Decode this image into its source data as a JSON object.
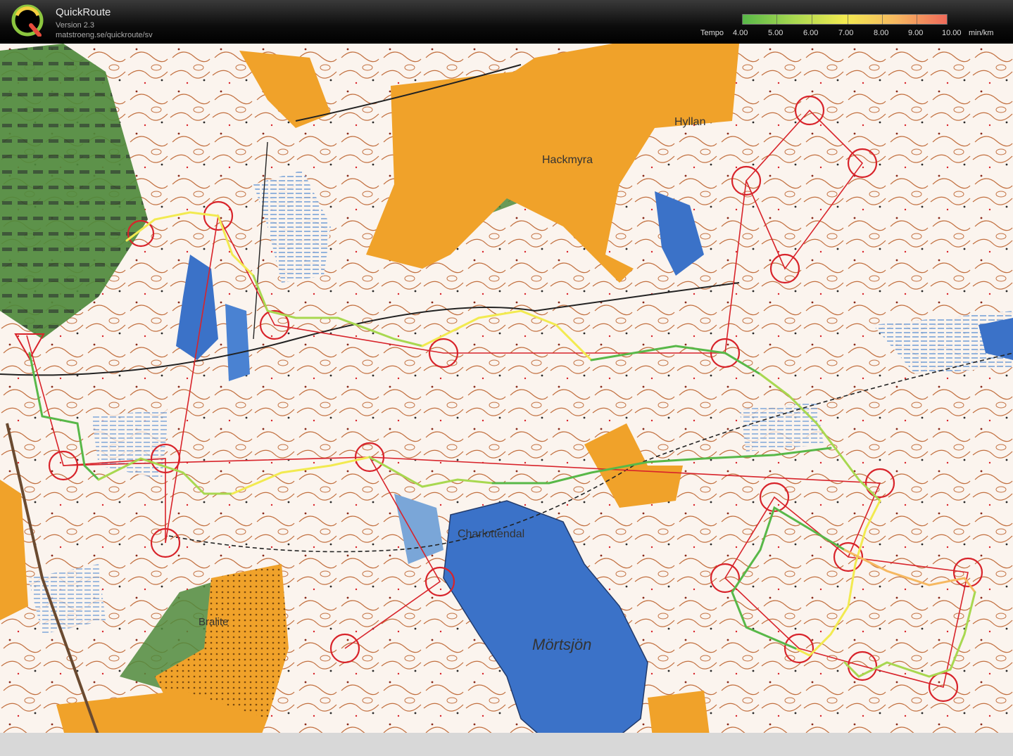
{
  "app": {
    "title": "QuickRoute",
    "version": "Version 2.3",
    "url": "matstroeng.se/quickroute/sv",
    "logo_letter": "Q"
  },
  "legend": {
    "prefix": "Tempo",
    "unit": "min/km",
    "values": [
      "4.00",
      "5.00",
      "6.00",
      "7.00",
      "8.00",
      "9.00",
      "10.00"
    ],
    "colors": [
      "#58b848",
      "#a8d850",
      "#f2ea50",
      "#f6b860",
      "#f06a5a"
    ]
  },
  "map": {
    "place_names": {
      "hyllan": "Hyllan",
      "hackmyra": "Hackmyra",
      "charlottendal": "Charlottendal",
      "bralite": "Bralite",
      "mortsjon": "Mörtsjön"
    },
    "colors": {
      "paper": "#fbf4ee",
      "open_land": "#f0a22a",
      "water": "#3b72c8",
      "marsh": "#7aa6d8",
      "green": "#3f7a32",
      "contour": "#c27040",
      "course": "#d8232a"
    }
  }
}
